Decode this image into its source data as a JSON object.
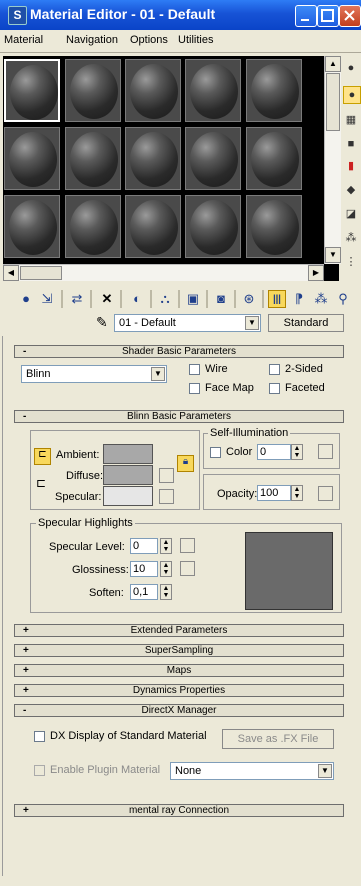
{
  "window": {
    "title": "Material Editor - 01 - Default",
    "app_icon": "3ds-max-icon",
    "controls": [
      "minimize-icon",
      "maximize-icon",
      "close-icon"
    ]
  },
  "menu": {
    "items": [
      "Material",
      "Navigation",
      "Options",
      "Utilities"
    ]
  },
  "sample_slots": {
    "rows": 3,
    "cols": 5,
    "selected_index": 0
  },
  "side_tools": [
    "sample-type-icon",
    "backlight-icon",
    "background-icon",
    "uv-tiling-icon",
    "video-color-check-icon",
    "make-preview-icon",
    "options-icon",
    "sample-select-icon",
    "material-navigator-icon"
  ],
  "toolbar": {
    "icons": [
      "get-material-icon",
      "put-to-scene-icon",
      "assign-to-selection-icon",
      "reset-map-icon",
      "make-unique-icon",
      "put-to-library-icon",
      "material-effects-channel-icon",
      "show-map-icon",
      "show-end-result-icon",
      "go-to-parent-icon",
      "go-forward-sibling-icon",
      "pick-from-object-icon",
      "apply-material-icon"
    ]
  },
  "name_row": {
    "material_name": "01 - Default",
    "type_button": "Standard"
  },
  "shader_basic": {
    "title": "Shader Basic Parameters",
    "shader": "Blinn",
    "checkboxes": {
      "wire": "Wire",
      "two_sided": "2-Sided",
      "face_map": "Face Map",
      "faceted": "Faceted"
    }
  },
  "blinn_basic": {
    "title": "Blinn Basic Parameters",
    "ambient_label": "Ambient:",
    "diffuse_label": "Diffuse:",
    "specular_label": "Specular:",
    "ambient_color": "#A8A8A8",
    "diffuse_color": "#A8A8A8",
    "specular_color": "#E6E6E6",
    "self_illum": {
      "group_label": "Self-Illumination",
      "color_label": "Color",
      "value": "0"
    },
    "opacity_label": "Opacity:",
    "opacity_value": "100"
  },
  "specular_highlights": {
    "group_label": "Specular Highlights",
    "specular_level_label": "Specular Level:",
    "specular_level_value": "0",
    "glossiness_label": "Glossiness:",
    "glossiness_value": "10",
    "soften_label": "Soften:",
    "soften_value": "0,1"
  },
  "rollouts": [
    {
      "sign": "+",
      "title": "Extended Parameters"
    },
    {
      "sign": "+",
      "title": "SuperSampling"
    },
    {
      "sign": "+",
      "title": "Maps"
    },
    {
      "sign": "+",
      "title": "Dynamics Properties"
    },
    {
      "sign": "-",
      "title": "DirectX Manager"
    }
  ],
  "directx": {
    "dx_display_label": "DX Display of Standard Material",
    "save_button": "Save as .FX File",
    "enable_plugin_label": "Enable Plugin Material",
    "plugin_value": "None"
  },
  "mental_ray": {
    "sign": "+",
    "title": "mental ray Connection"
  }
}
